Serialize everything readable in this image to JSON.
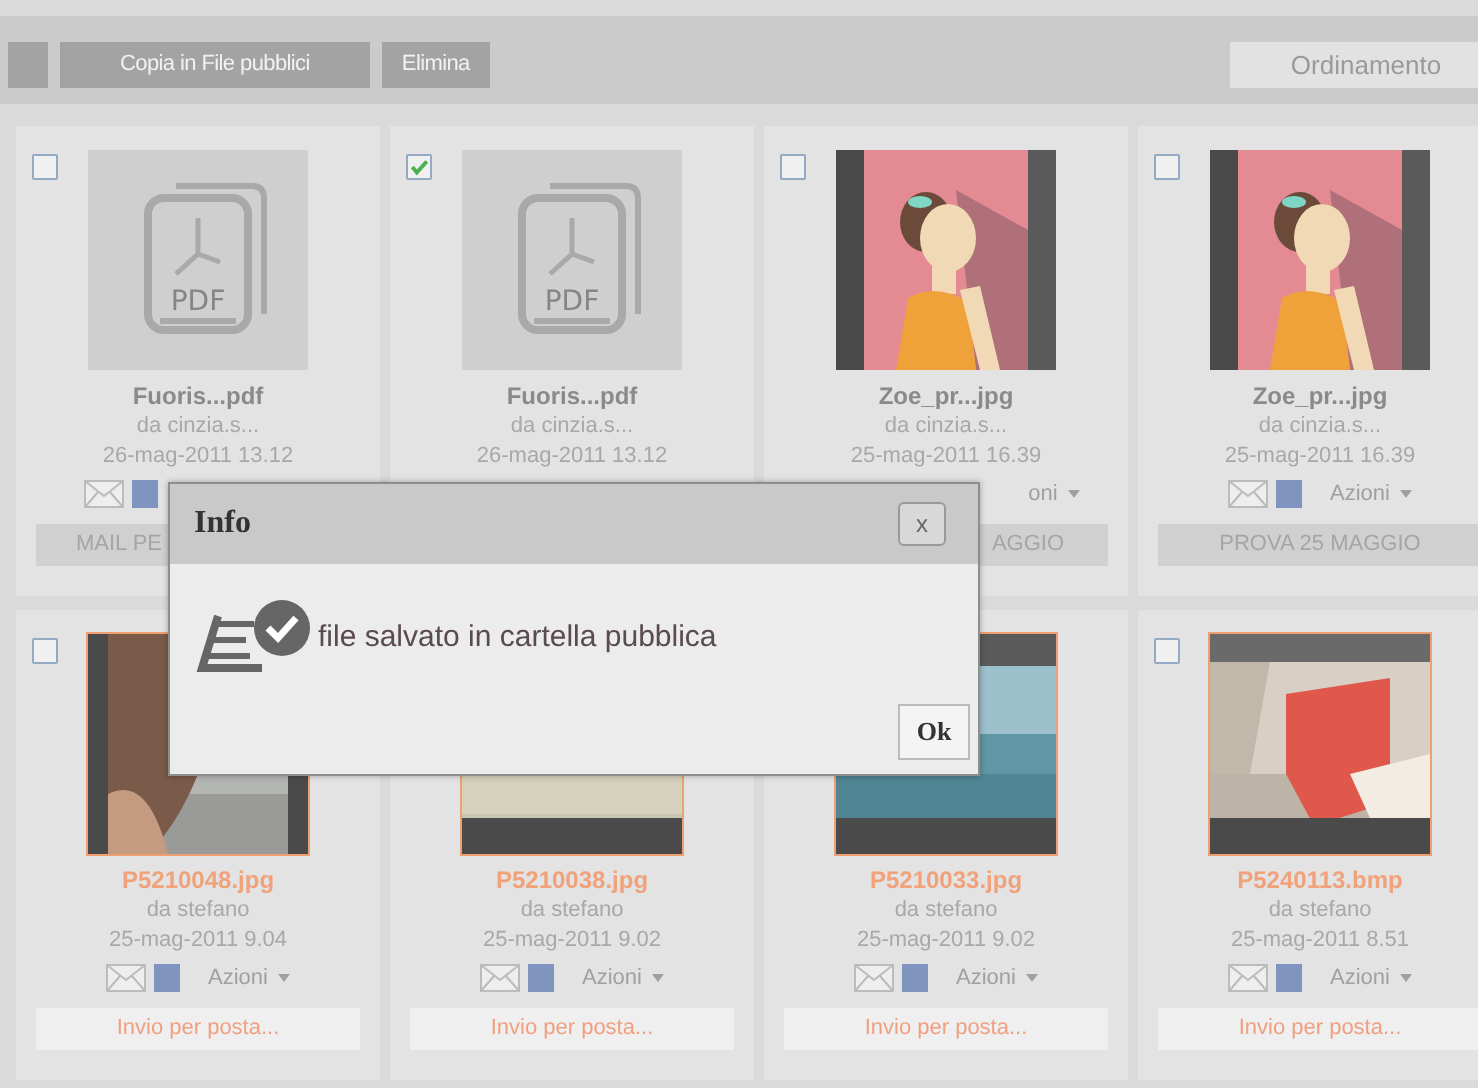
{
  "toolbar": {
    "buttons": [
      "Copia in File pubblici",
      "Elimina"
    ],
    "sort_button": "Ordinamento"
  },
  "files": [
    {
      "kind": "pdf",
      "pdf_label": "PDF",
      "checked": false,
      "highlighted": false,
      "name": "Fuoris...pdf",
      "author": "da cinzia.s...",
      "date": "26-mag-2011 13.12",
      "share_icons": true,
      "tag": {
        "text": "MAIL PE",
        "kind": "label",
        "cut_end": true
      }
    },
    {
      "kind": "pdf",
      "pdf_label": "PDF",
      "checked": true,
      "highlighted": false,
      "name": "Fuoris...pdf",
      "author": "da cinzia.s...",
      "date": "26-mag-2011 13.12",
      "share_icons": false
    },
    {
      "kind": "picture",
      "checked": false,
      "highlighted": false,
      "name": "Zoe_pr...jpg",
      "author": "da cinzia.s...",
      "date": "25-mag-2011 16.39",
      "share_icons": false,
      "actions": {
        "text": "oni",
        "cut_start": true
      },
      "tag": {
        "text": "AGGIO",
        "kind": "label",
        "cut_start": true
      }
    },
    {
      "kind": "picture",
      "checked": false,
      "highlighted": false,
      "name": "Zoe_pr...jpg",
      "author": "da cinzia.s...",
      "date": "25-mag-2011 16.39",
      "share_icons": true,
      "actions": {
        "text": "Azioni"
      },
      "tag": {
        "text": "PROVA 25 MAGGIO",
        "kind": "label"
      }
    },
    {
      "kind": "picture",
      "checked": false,
      "highlighted": true,
      "name": "P5210048.jpg",
      "author": "da stefano",
      "date": "25-mag-2011 9.04",
      "share_icons": true,
      "actions": {
        "text": "Azioni"
      },
      "tag": {
        "text": "Invio per posta...",
        "kind": "link"
      }
    },
    {
      "kind": "picture",
      "highlighted": true,
      "name": "P5210038.jpg",
      "author": "da stefano",
      "date": "25-mag-2011 9.02",
      "share_icons": true,
      "actions": {
        "text": "Azioni"
      },
      "tag": {
        "text": "Invio per posta...",
        "kind": "link"
      }
    },
    {
      "kind": "picture",
      "highlighted": true,
      "name": "P5210033.jpg",
      "author": "da stefano",
      "date": "25-mag-2011 9.02",
      "share_icons": true,
      "actions": {
        "text": "Azioni"
      },
      "tag": {
        "text": "Invio per posta...",
        "kind": "link"
      }
    },
    {
      "kind": "picture",
      "checked": false,
      "highlighted": true,
      "name": "P5240113.bmp",
      "author": "da stefano",
      "date": "25-mag-2011 8.51",
      "share_icons": true,
      "actions": {
        "text": "Azioni"
      },
      "tag": {
        "text": "Invio per posta...",
        "kind": "link"
      }
    }
  ],
  "dialog": {
    "title": "Info",
    "close": "x",
    "message": "file salvato in cartella pubblica",
    "ok": "Ok"
  }
}
